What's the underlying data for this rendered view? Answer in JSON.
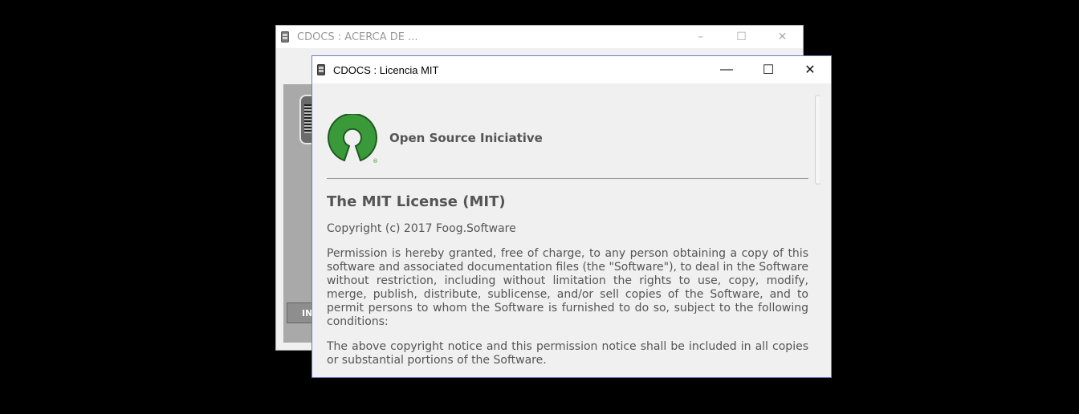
{
  "back_window": {
    "title": "CDOCS : ACERCA DE ...",
    "minimize": "–",
    "maximize": "☐",
    "close": "✕",
    "button_text": "IN"
  },
  "front_window": {
    "title": "CDOCS : Licencia MIT",
    "minimize": "—",
    "maximize": "☐",
    "close": "✕",
    "colors": {
      "title_border": "#6a7dc8",
      "osi_green": "#3a9a3a"
    },
    "osi_label": "Open Source Iniciative",
    "osi_logo_mark": "®",
    "license_title": "The MIT License (MIT)",
    "copyright": "Copyright (c) 2017 Foog.Software",
    "paragraph1": "Permission is hereby granted, free of charge, to any person obtaining a copy of this software and associated documentation files (the \"Software\"), to deal in the Software without restriction, including without limitation the rights to use, copy, modify, merge, publish, distribute, sublicense, and/or sell copies of the Software, and to permit persons to whom the Software is furnished to do so, subject to the following conditions:",
    "paragraph2": "The above copyright notice and this permission notice shall be included in all copies or substantial portions of the Software."
  }
}
